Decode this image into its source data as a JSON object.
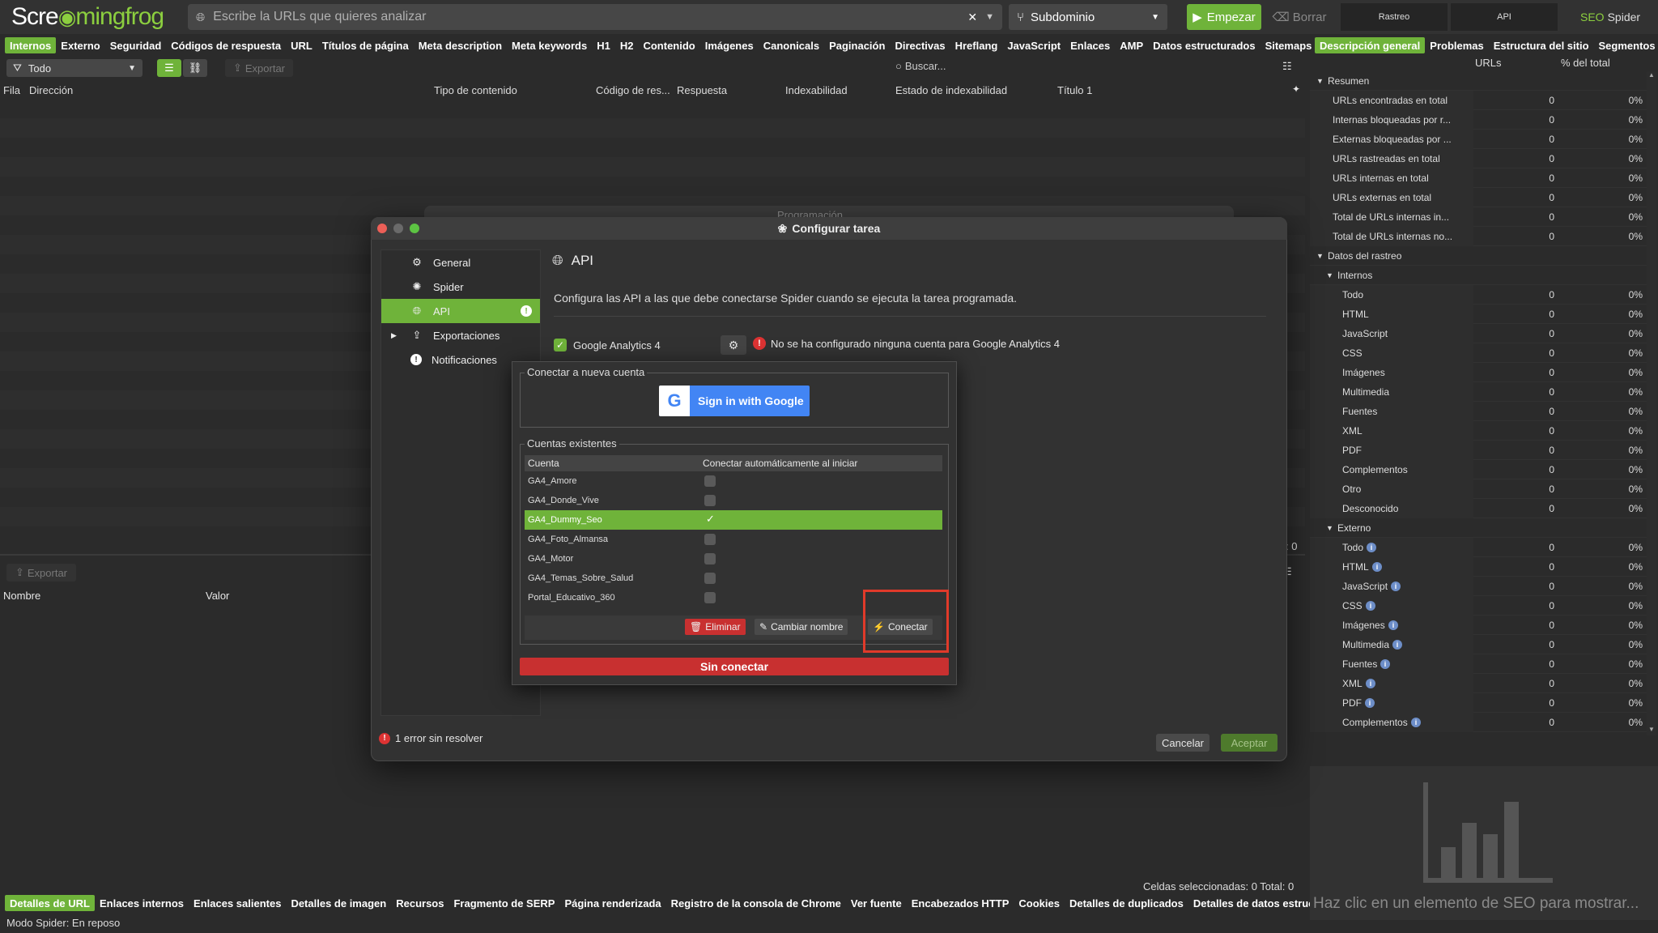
{
  "header": {
    "logo_a": "Scre",
    "logo_b": "mingfrog",
    "url_placeholder": "Escribe la URLs que quieres analizar",
    "mode": "Subdominio",
    "start": "Empezar",
    "clear": "Borrar",
    "crawl": "Rastreo",
    "api": "API",
    "product_a": "SEO",
    "product_b": "Spider"
  },
  "tabs": [
    "Internos",
    "Externo",
    "Seguridad",
    "Códigos de respuesta",
    "URL",
    "Títulos de página",
    "Meta description",
    "Meta keywords",
    "H1",
    "H2",
    "Contenido",
    "Imágenes",
    "Canonicals",
    "Paginación",
    "Directivas",
    "Hreflang",
    "JavaScript",
    "Enlaces",
    "AMP",
    "Datos estructurados",
    "Sitemaps"
  ],
  "toolbar": {
    "filter": "Todo",
    "export": "Exportar",
    "search": "Buscar..."
  },
  "columns": [
    "Fila",
    "Dirección",
    "Tipo de contenido",
    "Código de res...",
    "Respuesta",
    "Indexabilidad",
    "Estado de indexabilidad",
    "Título 1"
  ],
  "lower": {
    "export": "Exportar",
    "name_col": "Nombre",
    "value_col": "Valor",
    "side_count": ": 0"
  },
  "bottom_tabs": [
    "Detalles de URL",
    "Enlaces internos",
    "Enlaces salientes",
    "Detalles de imagen",
    "Recursos",
    "Fragmento de SERP",
    "Página renderizada",
    "Registro de la consola de Chrome",
    "Ver fuente",
    "Encabezados HTTP",
    "Cookies",
    "Detalles de duplicados",
    "Detalles de datos estructurad"
  ],
  "status": "Modo Spider: En reposo",
  "selected_cells": "Celdas seleccionadas: 0  Total: 0",
  "right": {
    "tabs": [
      "Descripción general",
      "Problemas",
      "Estructura del sitio",
      "Segmentos"
    ],
    "col_urls": "URLs",
    "col_pct": "% del total",
    "rows": [
      {
        "label": "Resumen",
        "indent": 0,
        "header": true
      },
      {
        "label": "URLs encontradas en total",
        "indent": 1,
        "v": "0",
        "p": "0%"
      },
      {
        "label": "Internas bloqueadas por r...",
        "indent": 1,
        "v": "0",
        "p": "0%"
      },
      {
        "label": "Externas bloqueadas por ...",
        "indent": 1,
        "v": "0",
        "p": "0%"
      },
      {
        "label": "URLs rastreadas en total",
        "indent": 1,
        "v": "0",
        "p": "0%"
      },
      {
        "label": "URLs internas en total",
        "indent": 1,
        "v": "0",
        "p": "0%"
      },
      {
        "label": "URLs externas en total",
        "indent": 1,
        "v": "0",
        "p": "0%"
      },
      {
        "label": "Total de URLs internas in...",
        "indent": 1,
        "v": "0",
        "p": "0%"
      },
      {
        "label": "Total de URLs internas no...",
        "indent": 1,
        "v": "0",
        "p": "0%"
      },
      {
        "label": "Datos del rastreo",
        "indent": 0,
        "header": true
      },
      {
        "label": "Internos",
        "indent": 1,
        "header": true
      },
      {
        "label": "Todo",
        "indent": 2,
        "v": "0",
        "p": "0%"
      },
      {
        "label": "HTML",
        "indent": 2,
        "v": "0",
        "p": "0%"
      },
      {
        "label": "JavaScript",
        "indent": 2,
        "v": "0",
        "p": "0%"
      },
      {
        "label": "CSS",
        "indent": 2,
        "v": "0",
        "p": "0%"
      },
      {
        "label": "Imágenes",
        "indent": 2,
        "v": "0",
        "p": "0%"
      },
      {
        "label": "Multimedia",
        "indent": 2,
        "v": "0",
        "p": "0%"
      },
      {
        "label": "Fuentes",
        "indent": 2,
        "v": "0",
        "p": "0%"
      },
      {
        "label": "XML",
        "indent": 2,
        "v": "0",
        "p": "0%"
      },
      {
        "label": "PDF",
        "indent": 2,
        "v": "0",
        "p": "0%"
      },
      {
        "label": "Complementos",
        "indent": 2,
        "v": "0",
        "p": "0%"
      },
      {
        "label": "Otro",
        "indent": 2,
        "v": "0",
        "p": "0%"
      },
      {
        "label": "Desconocido",
        "indent": 2,
        "v": "0",
        "p": "0%"
      },
      {
        "label": "Externo",
        "indent": 1,
        "header": true
      },
      {
        "label": "Todo",
        "indent": 2,
        "v": "0",
        "p": "0%",
        "info": true
      },
      {
        "label": "HTML",
        "indent": 2,
        "v": "0",
        "p": "0%",
        "info": true
      },
      {
        "label": "JavaScript",
        "indent": 2,
        "v": "0",
        "p": "0%",
        "info": true
      },
      {
        "label": "CSS",
        "indent": 2,
        "v": "0",
        "p": "0%",
        "info": true
      },
      {
        "label": "Imágenes",
        "indent": 2,
        "v": "0",
        "p": "0%",
        "info": true
      },
      {
        "label": "Multimedia",
        "indent": 2,
        "v": "0",
        "p": "0%",
        "info": true
      },
      {
        "label": "Fuentes",
        "indent": 2,
        "v": "0",
        "p": "0%",
        "info": true
      },
      {
        "label": "XML",
        "indent": 2,
        "v": "0",
        "p": "0%",
        "info": true
      },
      {
        "label": "PDF",
        "indent": 2,
        "v": "0",
        "p": "0%",
        "info": true
      },
      {
        "label": "Complementos",
        "indent": 2,
        "v": "0",
        "p": "0%",
        "info": true
      }
    ],
    "chart_message": "Haz clic en un elemento de SEO para mostrar..."
  },
  "dialog": {
    "behind_title": "Programación",
    "title": "Configurar tarea",
    "nav": [
      {
        "label": "General",
        "icon": "gear"
      },
      {
        "label": "Spider",
        "icon": "spider"
      },
      {
        "label": "API",
        "icon": "globe",
        "selected": true
      },
      {
        "label": "Exportaciones",
        "icon": "upload"
      },
      {
        "label": "Notificaciones",
        "icon": "alert"
      }
    ],
    "section_title": "API",
    "description": "Configura las API a las que debe conectarse Spider cuando se ejecuta la tarea programada.",
    "ga4_label": "Google Analytics 4",
    "ga4_error": "No se ha configurado ninguna cuenta para Google Analytics 4",
    "error_footer": "1 error sin resolver",
    "cancel": "Cancelar",
    "accept": "Aceptar"
  },
  "popup": {
    "new_account_legend": "Conectar a nueva cuenta",
    "google_button": "Sign in with Google",
    "existing_legend": "Cuentas existentes",
    "col_account": "Cuenta",
    "col_auto": "Conectar automáticamente al iniciar",
    "accounts": [
      {
        "name": "GA4_Amore",
        "checked": false
      },
      {
        "name": "GA4_Donde_Vive",
        "checked": false
      },
      {
        "name": "GA4_Dummy_Seo",
        "checked": true,
        "selected": true
      },
      {
        "name": "GA4_Foto_Almansa",
        "checked": false
      },
      {
        "name": "GA4_Motor",
        "checked": false
      },
      {
        "name": "GA4_Temas_Sobre_Salud",
        "checked": false
      },
      {
        "name": "Portal_Educativo_360",
        "checked": false
      }
    ],
    "delete": "Eliminar",
    "rename": "Cambiar nombre",
    "connect": "Conectar",
    "not_connected": "Sin conectar"
  }
}
